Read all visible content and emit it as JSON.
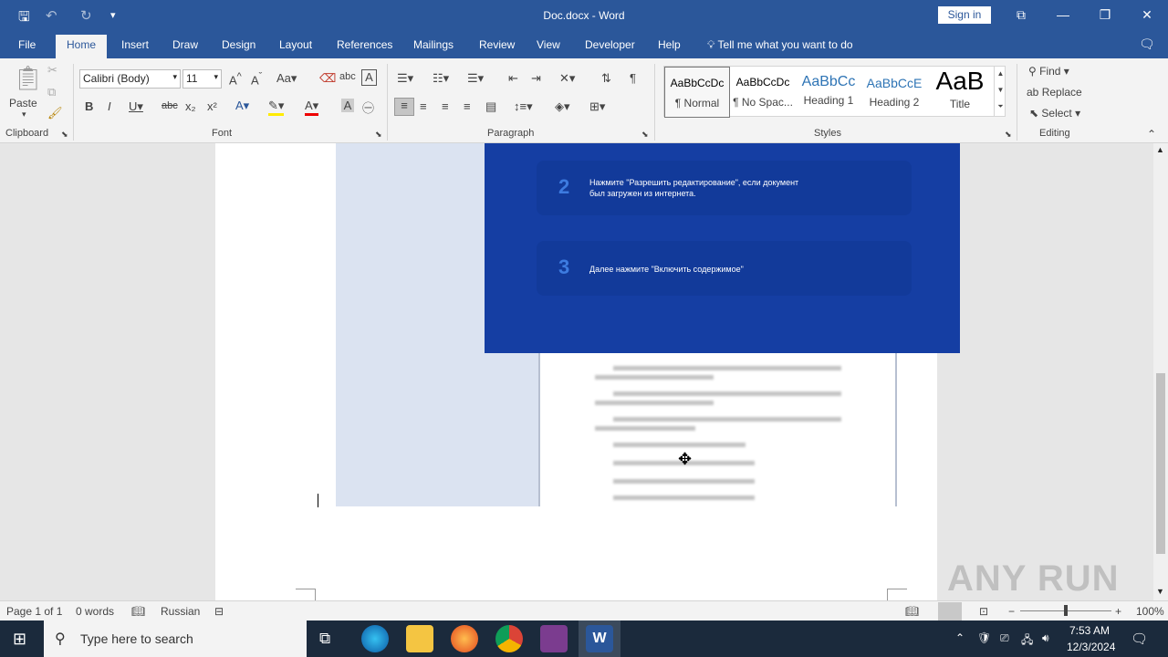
{
  "window": {
    "title": "Doc.docx  -  Word",
    "sign_in": "Sign in"
  },
  "tabs": [
    {
      "label": "File"
    },
    {
      "label": "Home"
    },
    {
      "label": "Insert"
    },
    {
      "label": "Draw"
    },
    {
      "label": "Design"
    },
    {
      "label": "Layout"
    },
    {
      "label": "References"
    },
    {
      "label": "Mailings"
    },
    {
      "label": "Review"
    },
    {
      "label": "View"
    },
    {
      "label": "Developer"
    },
    {
      "label": "Help"
    }
  ],
  "tell_me": "Tell me what you want to do",
  "clipboard": {
    "paste": "Paste",
    "group": "Clipboard"
  },
  "font": {
    "name": "Calibri (Body)",
    "size": "11",
    "group": "Font"
  },
  "paragraph": {
    "group": "Paragraph"
  },
  "styles": {
    "group": "Styles",
    "items": [
      {
        "preview": "AaBbCcDc",
        "name": "¶ Normal"
      },
      {
        "preview": "AaBbCcDc",
        "name": "¶ No Spac..."
      },
      {
        "preview": "AaBbCc",
        "name": "Heading 1"
      },
      {
        "preview": "AaBbCcE",
        "name": "Heading 2"
      },
      {
        "preview": "AaB",
        "name": "Title"
      }
    ]
  },
  "editing": {
    "find": "Find",
    "replace": "Replace",
    "select": "Select",
    "group": "Editing"
  },
  "document": {
    "steps": [
      {
        "num": "2",
        "line1": "Нажмите \"Разрешить редактирование\", если документ",
        "line2": "был загружен из интернета."
      },
      {
        "num": "3",
        "line1": "Далее нажмите \"Включить содержимое\"",
        "line2": ""
      }
    ]
  },
  "status": {
    "page": "Page 1 of 1",
    "words": "0 words",
    "language": "Russian",
    "zoom": "100%"
  },
  "taskbar": {
    "search_placeholder": "Type here to search",
    "time": "7:53 AM",
    "date": "12/3/2024"
  },
  "watermark": "ANY RUN",
  "colors": {
    "accent": "#2b579a",
    "doc_blue": "#153ea3"
  }
}
